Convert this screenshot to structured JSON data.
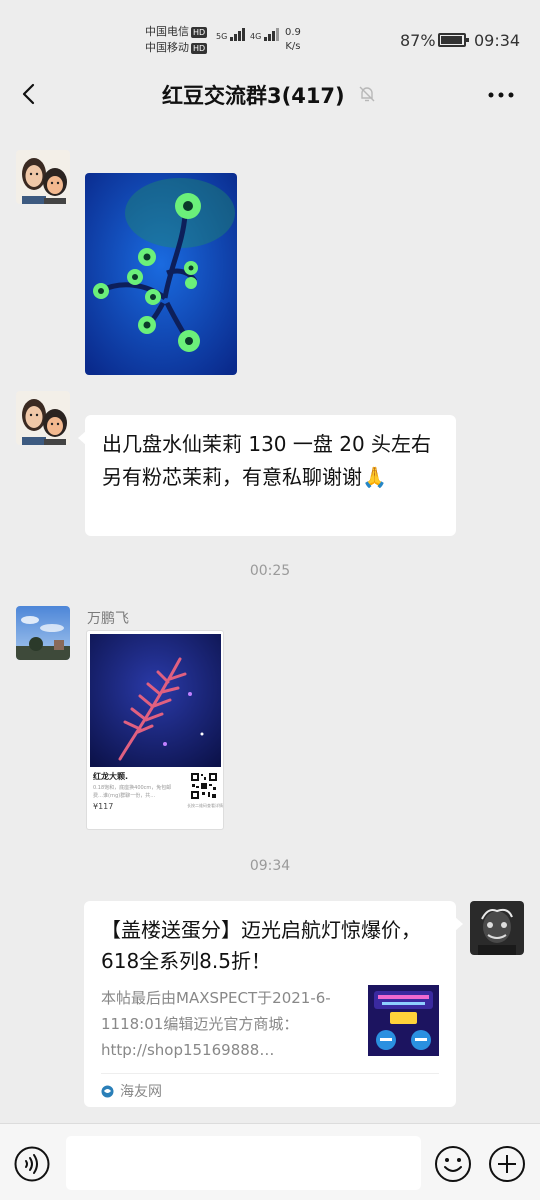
{
  "status_bar": {
    "carrier1": "中国电信",
    "carrier2": "中国移动",
    "hd_label": "HD",
    "net1": "5G",
    "net2": "4G",
    "speed_value": "0.9",
    "speed_unit": "K/s",
    "battery_pct": "87%",
    "battery_level": 0.87,
    "time": "09:34"
  },
  "header": {
    "title": "红豆交流群3(417)",
    "back_icon": "chevron-left-icon",
    "mute_icon": "bell-off-icon",
    "more_icon": "more-dots-icon"
  },
  "messages": {
    "text1": "出几盘水仙茉莉 130 一盘 20 头左右",
    "text2": "另有粉芯茉莉，有意私聊谢谢🙏",
    "time1": "00:25",
    "sender2": "万鹏飞",
    "product": {
      "title": "红龙大颗.",
      "desc": "0.18饱和，底座换400cm，免包邮费…谁(rng)群聊一份，共…",
      "price": "¥117",
      "qr_note": "长按二维码查看详情"
    },
    "time2": "09:34",
    "link": {
      "title": "【盖楼送蛋分】迈光启航灯惊爆价，618全系列8.5折！",
      "desc": "本帖最后由MAXSPECT于2021-6-1118:01编辑迈光官方商城：http://shop15169888…",
      "source": "海友网"
    }
  },
  "input": {
    "placeholder": ""
  },
  "colors": {
    "background": "#ededed",
    "bubble": "#ffffff",
    "meta_text": "#9a9a9a"
  }
}
